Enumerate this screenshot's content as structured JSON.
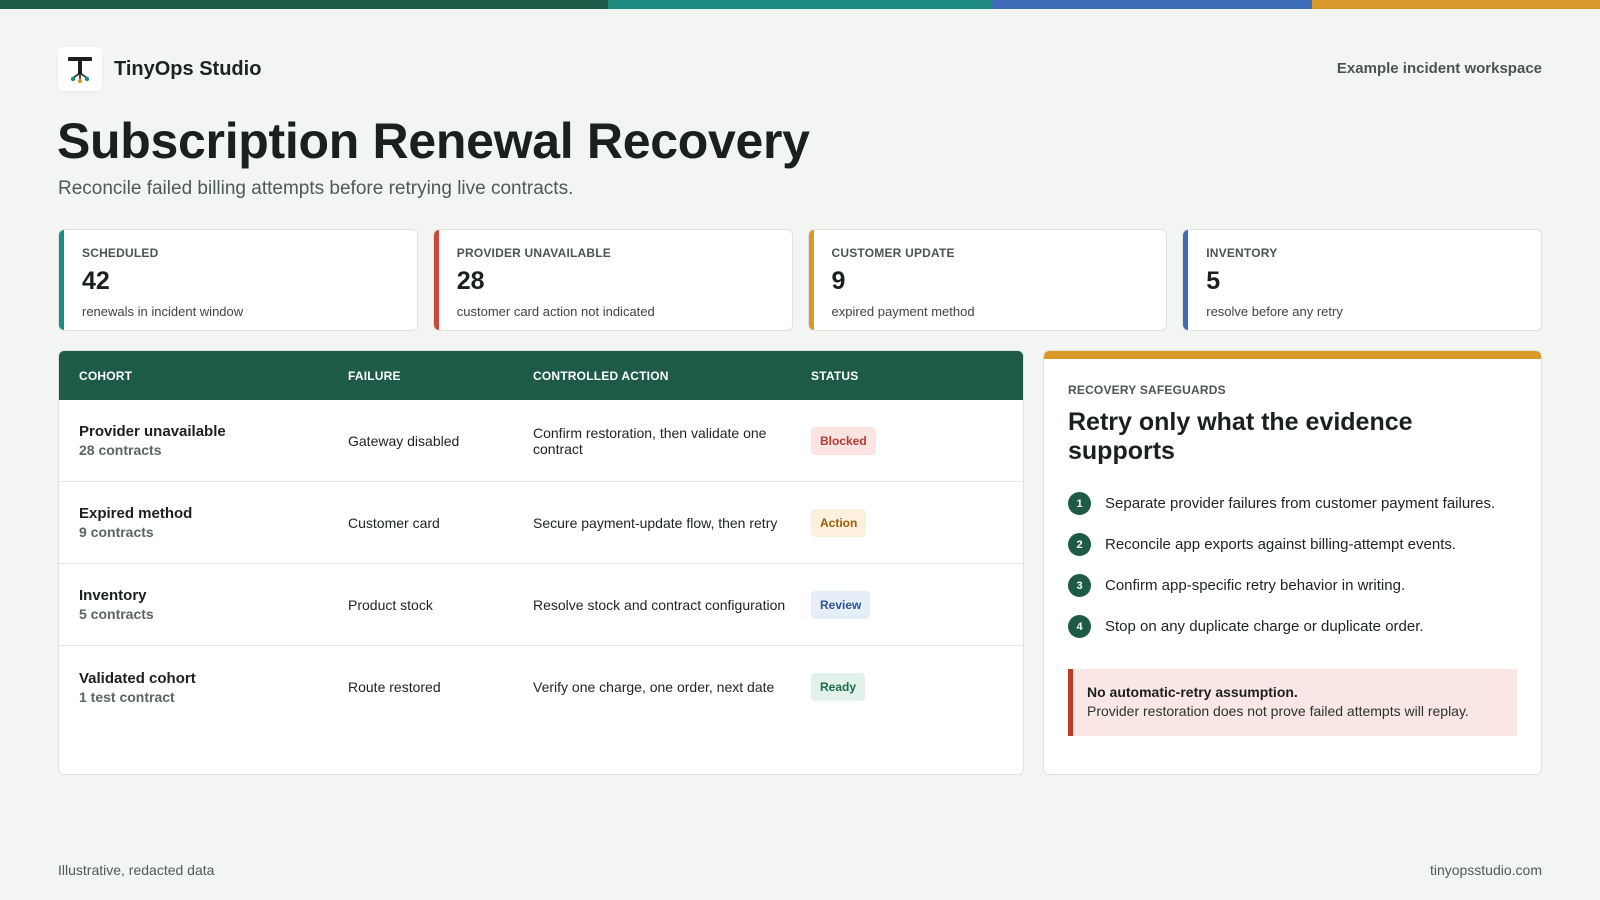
{
  "colors": {
    "primary": "#1e5a48",
    "teal": "#1f8a80",
    "red": "#c84a3c",
    "amber": "#d8982a",
    "blue": "#3f6cb8"
  },
  "brand": {
    "logo_icon": "tinyops-logo-icon",
    "name": "TinyOps Studio"
  },
  "header": {
    "workspace_label": "Example incident workspace"
  },
  "page": {
    "title": "Subscription Renewal Recovery",
    "subtitle": "Reconcile failed billing attempts before retrying live contracts."
  },
  "kpis": [
    {
      "label": "SCHEDULED",
      "value": "42",
      "description": "renewals in incident window",
      "accent": "#1f8a80"
    },
    {
      "label": "PROVIDER UNAVAILABLE",
      "value": "28",
      "description": "customer card action not indicated",
      "accent": "#c84a3c"
    },
    {
      "label": "CUSTOMER UPDATE",
      "value": "9",
      "description": "expired payment method",
      "accent": "#d8982a"
    },
    {
      "label": "INVENTORY",
      "value": "5",
      "description": "resolve before any retry",
      "accent": "#3f6cb8"
    }
  ],
  "table": {
    "headers": [
      "COHORT",
      "FAILURE",
      "CONTROLLED ACTION",
      "STATUS"
    ],
    "rows": [
      {
        "cohort": "Provider unavailable",
        "count": "28 contracts",
        "failure": "Gateway disabled",
        "action": "Confirm restoration, then validate one contract",
        "status": "Blocked"
      },
      {
        "cohort": "Expired method",
        "count": "9 contracts",
        "failure": "Customer card",
        "action": "Secure payment-update flow, then retry",
        "status": "Action"
      },
      {
        "cohort": "Inventory",
        "count": "5 contracts",
        "failure": "Product stock",
        "action": "Resolve stock and contract configuration",
        "status": "Review"
      },
      {
        "cohort": "Validated cohort",
        "count": "1 test contract",
        "failure": "Route restored",
        "action": "Verify one charge, one order, next date",
        "status": "Ready"
      }
    ]
  },
  "safeguards": {
    "eyebrow": "RECOVERY SAFEGUARDS",
    "title": "Retry only what the evidence supports",
    "steps": [
      {
        "num": "1",
        "text": "Separate provider failures from customer payment failures."
      },
      {
        "num": "2",
        "text": "Reconcile app exports against billing-attempt events."
      },
      {
        "num": "3",
        "text": "Confirm app-specific retry behavior in writing."
      },
      {
        "num": "4",
        "text": "Stop on any duplicate charge or duplicate order."
      }
    ],
    "alert": {
      "title": "No automatic-retry assumption.",
      "body": "Provider restoration does not prove failed attempts will replay."
    }
  },
  "footer": {
    "left": "Illustrative, redacted data",
    "right": "tinyopsstudio.com"
  }
}
